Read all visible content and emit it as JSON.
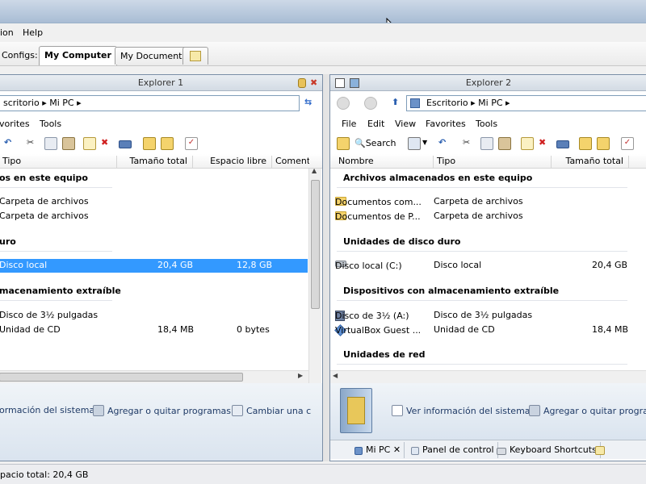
{
  "menubar": {
    "items": [
      "ion",
      "Help"
    ]
  },
  "configs": {
    "label": "Configs:",
    "tabs": [
      "My Computer",
      "My Documents"
    ]
  },
  "left": {
    "title": "Explorer 1",
    "address": "scritorio ▸ Mi PC ▸",
    "menu": [
      "vorites",
      "Tools"
    ],
    "columns": [
      "Tipo",
      "Tamaño total",
      "Espacio libre",
      "Coment"
    ],
    "groups": [
      "os en este equipo",
      "uro",
      "macenamiento extraíble"
    ],
    "rows": [
      {
        "tipo": "Carpeta de archivos",
        "total": "",
        "free": ""
      },
      {
        "tipo": "Carpeta de archivos",
        "total": "",
        "free": ""
      },
      {
        "tipo": "Disco local",
        "total": "20,4 GB",
        "free": "12,8 GB"
      },
      {
        "tipo": "Disco de 3½ pulgadas",
        "total": "",
        "free": ""
      },
      {
        "tipo": "Unidad de CD",
        "total": "18,4 MB",
        "free": "0 bytes"
      }
    ],
    "tasks": [
      "ormación del sistema",
      "Agregar o quitar programas",
      "Cambiar una c"
    ]
  },
  "right": {
    "title": "Explorer 2",
    "address": "Escritorio ▸ Mi PC ▸",
    "menu": [
      "File",
      "Edit",
      "View",
      "Favorites",
      "Tools"
    ],
    "search": "Search",
    "columns": [
      "Nombre",
      "Tipo",
      "Tamaño total"
    ],
    "groups": [
      "Archivos almacenados en este equipo",
      "Unidades de disco duro",
      "Dispositivos con almacenamiento extraíble",
      "Unidades de red"
    ],
    "rows": [
      {
        "name": "Documentos com...",
        "tipo": "Carpeta de archivos",
        "total": "",
        "icon": "folder-icon"
      },
      {
        "name": "Documentos de P...",
        "tipo": "Carpeta de archivos",
        "total": "",
        "icon": "folder-icon"
      },
      {
        "name": "Disco local (C:)",
        "tipo": "Disco local",
        "total": "20,4 GB",
        "icon": "hard-drive-icon"
      },
      {
        "name": "Disco de 3½ (A:)",
        "tipo": "Disco de 3½ pulgadas",
        "total": "",
        "icon": "floppy-icon"
      },
      {
        "name": "VirtualBox Guest ...",
        "tipo": "Unidad de CD",
        "total": "18,4 MB",
        "icon": "cd-drive-icon"
      }
    ],
    "tasks": [
      "Ver información del sistema",
      "Agregar o quitar progran"
    ],
    "bottom_tabs": [
      "Mi PC",
      "Panel de control",
      "Keyboard Shortcuts"
    ]
  },
  "status": {
    "text": "pacio total: 20,4 GB"
  },
  "colors": {
    "selection": "#3399ff",
    "task_text": "#1f3a66"
  }
}
